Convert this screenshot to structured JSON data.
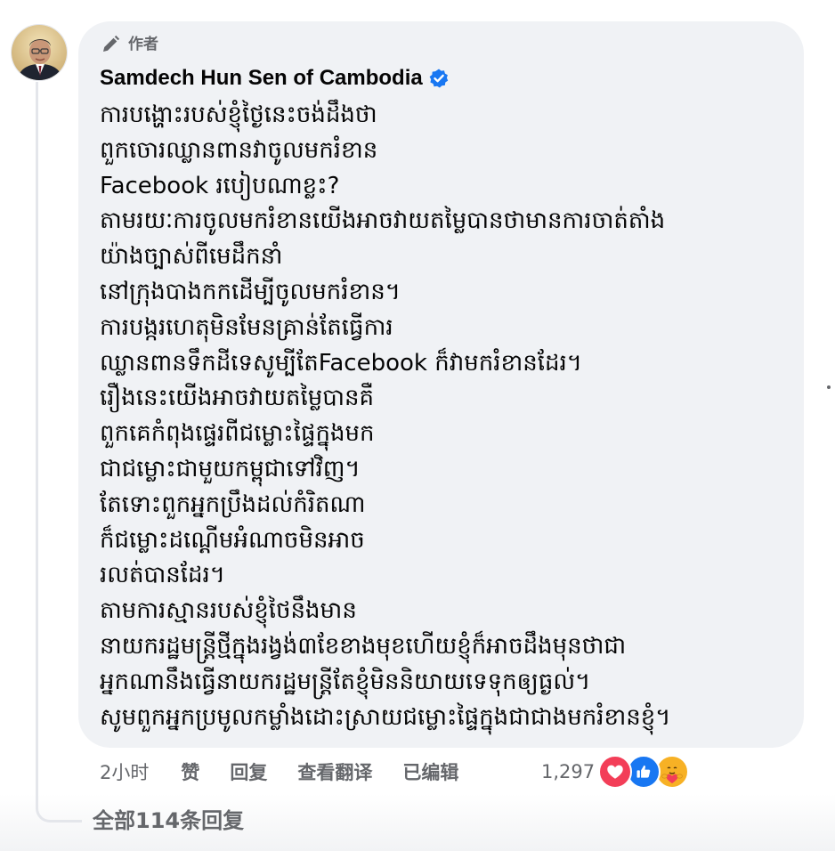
{
  "comment": {
    "author_badge": "作者",
    "author_name": "Samdech Hun Sen of Cambodia",
    "verified": true,
    "lines": [
      "ការបង្ហោះរបស់ខ្ញុំថ្ងៃនេះចង់ដឹងថា",
      "ពួកចោរឈ្លានពានវាចូលមករំខាន",
      "Facebook របៀបណាខ្លះ?",
      "តាមរយៈការចូលមករំខានយើងអាចវាយតម្លៃបានថាមានការចាត់តាំង",
      "យ៉ាងច្បាស់ពីមេដឹកនាំ",
      "នៅក្រុងបាងកកដើម្បីចូលមករំខាន។",
      "ការបង្ករហេតុមិនមែនគ្រាន់តែធ្វើការ",
      "ឈ្លានពានទឹកដីទេសូម្បីតែFacebook ក៏វាមករំខានដែរ។",
      "រឿងនេះយើងអាចវាយតម្លៃបានគឺ",
      "ពួកគេកំពុងផ្ទេរពីជម្លោះផ្ទៃក្នុងមក",
      "ជាជម្លោះជាមួយកម្ពុជាទៅវិញ។",
      "តែទោះពួកអ្នកប្រឹងដល់កំរិតណា",
      "ក៏ជម្លោះដណ្តើមអំណាចមិនអាច",
      "រលត់បានដែរ។",
      "តាមការស្មានរបស់ខ្ញុំថៃនឹងមាន",
      "នាយករដ្ឋមន្រ្តីថ្មីក្នុងរង្វង់៣ខែខាងមុខហើយខ្ញុំក៏អាចដឹងមុនថាជា",
      "អ្នកណានឹងធ្វើនាយករដ្ឋមន្រ្តីតែខ្ញុំមិននិយាយទេទុកឲ្យធ្ងល់។",
      "សូមពួកអ្នកប្រមូលកម្លាំងដោះស្រាយជម្លោះផ្ទៃក្នុងជាជាងមករំខានខ្ញុំ។"
    ]
  },
  "actions": {
    "time": "2小时",
    "like": "赞",
    "reply": "回复",
    "translate": "查看翻译",
    "edited": "已编辑"
  },
  "reactions": {
    "count": "1,297",
    "types": [
      "love-icon",
      "like-icon",
      "care-icon"
    ]
  },
  "replies": {
    "label": "全部114条回复"
  },
  "colors": {
    "bubble_bg": "#f0f2f5",
    "secondary_text": "#65676b",
    "verified_blue": "#1877f2",
    "love_red": "#f33e58",
    "care_yellow": "#f7b125"
  }
}
